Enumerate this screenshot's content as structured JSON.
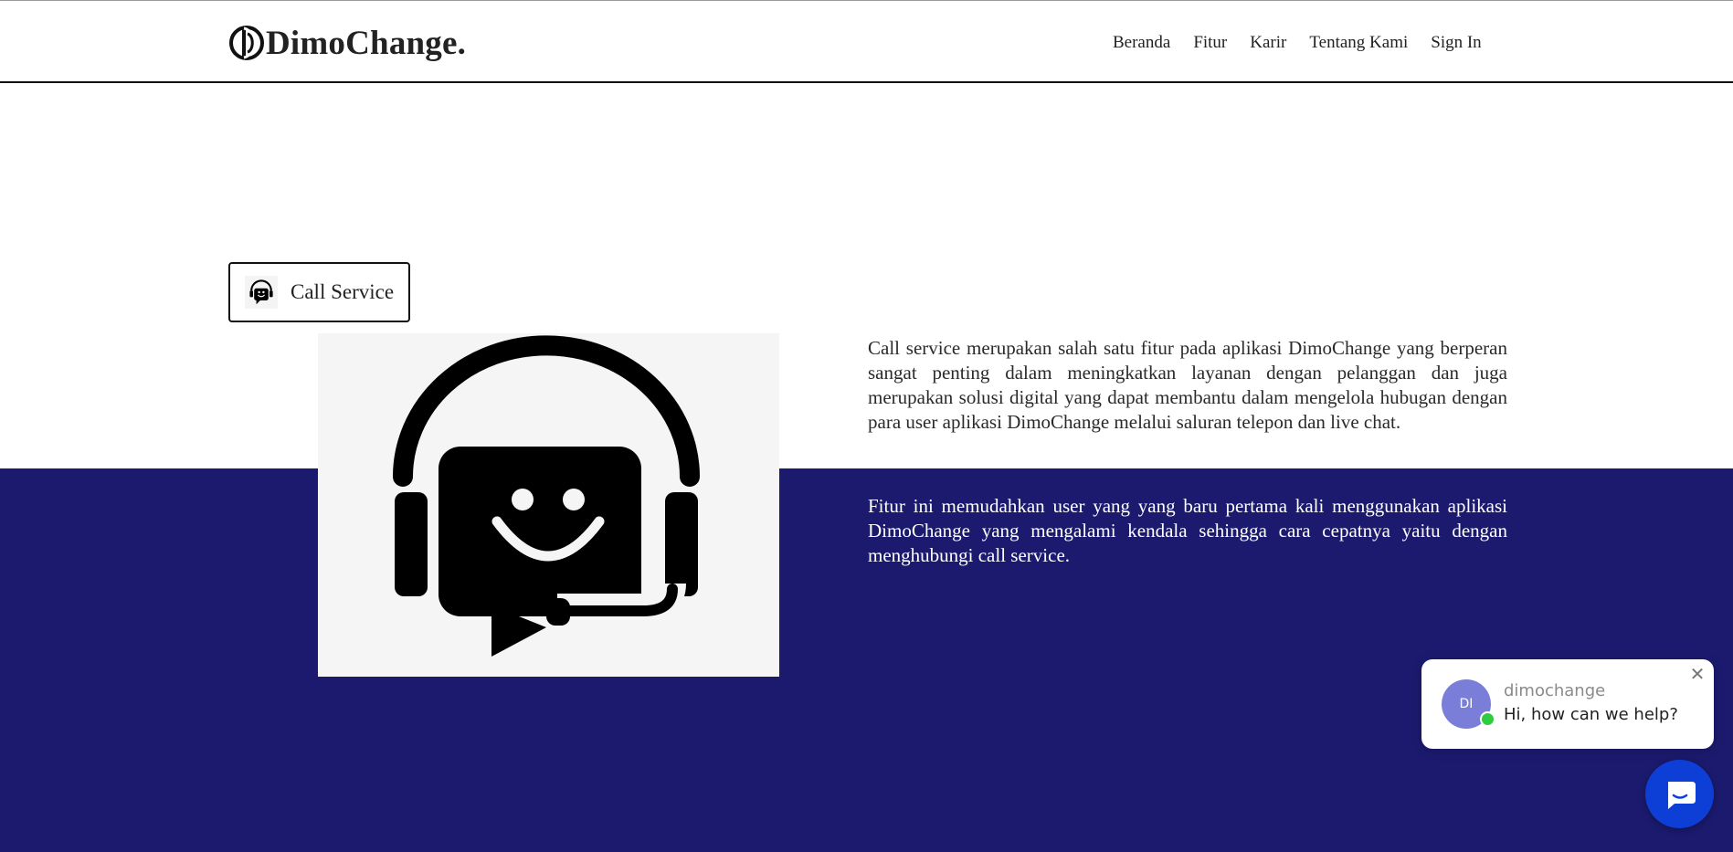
{
  "header": {
    "logo_text": "DimoChange.",
    "nav": [
      "Beranda",
      "Fitur",
      "Karir",
      "Tentang Kami",
      "Sign In"
    ]
  },
  "feature": {
    "badge_label": "Call Service",
    "image_icon": "headset-chat-smile-icon",
    "paragraph1": "Call service merupakan salah satu fitur pada aplikasi DimoChange yang berperan sangat penting dalam meningkatkan layanan dengan pelanggan dan juga merupakan solusi digital yang dapat membantu dalam mengelola hubugan dengan para user aplikasi DimoChange melalui saluran telepon dan live chat.",
    "paragraph2": "Fitur ini memudahkan user yang yang baru pertama kali menggunakan aplikasi DimoChange yang mengalami kendala sehingga cara cepatnya yaitu dengan menghubungi call service."
  },
  "chat_widget": {
    "avatar_initials": "DI",
    "name": "dimochange",
    "message": "Hi, how can we help?",
    "close_icon": "close-icon",
    "launcher_icon": "chat-bubble-icon"
  },
  "colors": {
    "band": "#1b1a6e",
    "launcher": "#0d3fd6",
    "avatar": "#7a7ed8",
    "online": "#2ecc40"
  }
}
